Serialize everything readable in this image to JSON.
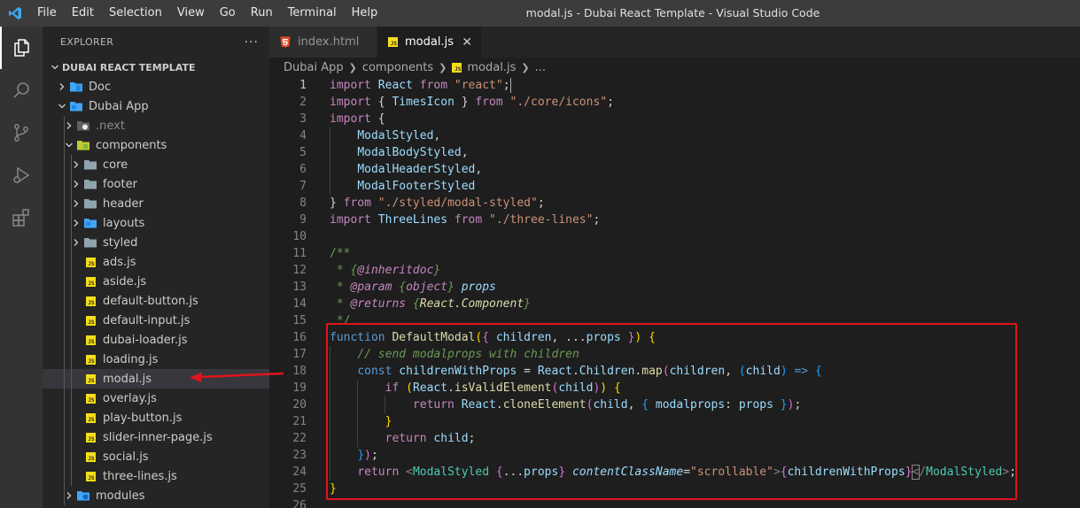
{
  "window": {
    "title": "modal.js - Dubai React Template - Visual Studio Code",
    "menu": [
      "File",
      "Edit",
      "Selection",
      "View",
      "Go",
      "Run",
      "Terminal",
      "Help"
    ]
  },
  "activity_bar": [
    "explorer-icon",
    "search-icon",
    "source-control-icon",
    "run-debug-icon",
    "extensions-icon"
  ],
  "sidebar": {
    "title": "EXPLORER",
    "more": "···",
    "section": "DUBAI REACT TEMPLATE",
    "tree": [
      {
        "label": "Doc",
        "type": "folder",
        "depth": 1,
        "open": false
      },
      {
        "label": "Dubai App",
        "type": "folder",
        "depth": 1,
        "open": true
      },
      {
        "label": ".next",
        "type": "folder",
        "depth": 2,
        "open": false,
        "dim": true
      },
      {
        "label": "components",
        "type": "folder",
        "depth": 2,
        "open": true
      },
      {
        "label": "core",
        "type": "folder",
        "depth": 3,
        "open": false
      },
      {
        "label": "footer",
        "type": "folder",
        "depth": 3,
        "open": false
      },
      {
        "label": "header",
        "type": "folder",
        "depth": 3,
        "open": false
      },
      {
        "label": "layouts",
        "type": "folder",
        "depth": 3,
        "open": false
      },
      {
        "label": "styled",
        "type": "folder",
        "depth": 3,
        "open": false
      },
      {
        "label": "ads.js",
        "type": "file",
        "depth": 3
      },
      {
        "label": "aside.js",
        "type": "file",
        "depth": 3
      },
      {
        "label": "default-button.js",
        "type": "file",
        "depth": 3
      },
      {
        "label": "default-input.js",
        "type": "file",
        "depth": 3
      },
      {
        "label": "dubai-loader.js",
        "type": "file",
        "depth": 3
      },
      {
        "label": "loading.js",
        "type": "file",
        "depth": 3
      },
      {
        "label": "modal.js",
        "type": "file",
        "depth": 3,
        "selected": true
      },
      {
        "label": "overlay.js",
        "type": "file",
        "depth": 3
      },
      {
        "label": "play-button.js",
        "type": "file",
        "depth": 3
      },
      {
        "label": "slider-inner-page.js",
        "type": "file",
        "depth": 3
      },
      {
        "label": "social.js",
        "type": "file",
        "depth": 3
      },
      {
        "label": "three-lines.js",
        "type": "file",
        "depth": 3
      },
      {
        "label": "modules",
        "type": "folder",
        "depth": 2,
        "open": false
      }
    ]
  },
  "tabs": [
    {
      "label": "index.html",
      "active": false
    },
    {
      "label": "modal.js",
      "active": true,
      "close": "✕"
    }
  ],
  "breadcrumbs": [
    "Dubai App",
    "components",
    "modal.js",
    "..."
  ],
  "editor": {
    "current_line": 1,
    "line_numbers": [
      "1",
      "2",
      "3",
      "4",
      "5",
      "6",
      "7",
      "8",
      "9",
      "10",
      "11",
      "12",
      "13",
      "14",
      "15",
      "16",
      "17",
      "18",
      "19",
      "20",
      "21",
      "22",
      "23",
      "24",
      "25",
      "26"
    ]
  },
  "colors": {
    "highlight_border": "#e0141b",
    "annotation_arrow": "#e0141b",
    "js_badge": "#f5de19",
    "folder_blue": "#42a5f5"
  }
}
